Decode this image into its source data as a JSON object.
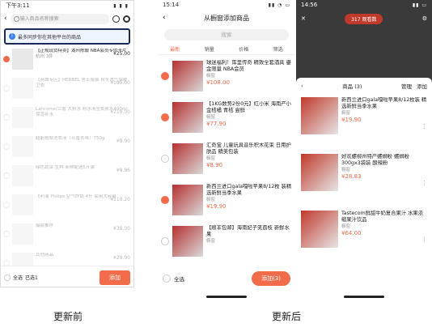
{
  "before": {
    "status": {
      "time": "下午3:11",
      "icons": "▮ ▮ ▮"
    },
    "search_placeholder": "输入商品名称搜索",
    "tip": "最多同步你在其他平台的商品",
    "items": [
      {
        "title": "【正规现货特卖】湖州陈酿 NBA会员专供卡片",
        "sub": "杭州 3件",
        "price": "¥25.00",
        "checked": true
      },
      {
        "title": "【商城专区】HERBEL 男士服装 秋冬透气保暖卫衣",
        "sub": "",
        "price": "¥199.00",
        "checked": false
      },
      {
        "title": "Lancome/兰蔻 大粉水 粉水清莹柔肤水400ml 保湿补水",
        "sub": "",
        "price": "¥219.00",
        "checked": false
      },
      {
        "title": "超能植翠洗衣液（花香去味）750g",
        "sub": "",
        "price": "¥9.90",
        "checked": false
      },
      {
        "title": "绿色蔬菜 生鲜 新鲜配送5斤装",
        "sub": "",
        "price": "¥9.96",
        "checked": false
      },
      {
        "title": "飞利浦 Philips 空气炸锅 4升 家用大容量",
        "sub": "",
        "price": "¥110.20",
        "checked": false
      },
      {
        "title": "爆款推荐",
        "sub": "",
        "price": "¥39.00",
        "checked": false
      },
      {
        "title": "其他商品",
        "sub": "",
        "price": "¥29.90",
        "checked": false
      }
    ],
    "bottom": {
      "select_all": "全选",
      "selected": "已选1",
      "add": "添加"
    }
  },
  "middle": {
    "status": {
      "time": "15:14",
      "icons": "▮▮ ◔ ▭"
    },
    "title": "从橱窗添加商品",
    "search_placeholder": "搜索",
    "tabs": [
      "最新",
      "销量",
      "价格",
      "筛选"
    ],
    "items": [
      {
        "title": "球迷福利！库里传奇 精致全套酒具 鎏金限量 NBA会员",
        "shop": "橱窗",
        "price": "¥108.00",
        "checked": true
      },
      {
        "title": "【1KG数势2份0元】红小米 海南产小金桔橘 青桔 尝鲜",
        "shop": "橱窗",
        "price": "¥77.90",
        "checked": true
      },
      {
        "title": "汇奇宝 儿童玩具音乐积木花束 日用护肤品 精美包装",
        "shop": "橱窗",
        "price": "¥8.90",
        "checked": false
      },
      {
        "title": "新西兰进口gala嘎啦苹果8/12枚 装精选新鲜当季水果",
        "shop": "橱窗",
        "price": "¥19.90",
        "checked": true
      },
      {
        "title": "【顺丰包邮】海南妃子笑荔枝 新鲜水果",
        "shop": "橱窗",
        "price": "",
        "checked": false
      }
    ],
    "bottom": {
      "select_all": "全选",
      "add": "添加(3)"
    }
  },
  "right": {
    "status": {
      "time": "14:56"
    },
    "viewers": "317 观看数",
    "sheet": {
      "title": "商品 (3)",
      "manage": "管理",
      "add": "添加"
    },
    "items": [
      {
        "title": "新西兰进口gala嘎啦苹果8/12枚装 精选新鲜当季水果",
        "shop": "橱窗",
        "price": "¥19.90"
      },
      {
        "title": "好欢螺柳州特产螺蛳粉 螺蛳粉 300gx3袋装 酸辣粉",
        "shop": "橱窗",
        "price": "¥28.83"
      },
      {
        "title": "Tastecom鲜甜牛奶复合果汁 水果浓缩果汁饮品",
        "shop": "橱窗",
        "price": "¥64.00"
      }
    ]
  },
  "captions": {
    "before": "更新前",
    "after": "更新后"
  }
}
